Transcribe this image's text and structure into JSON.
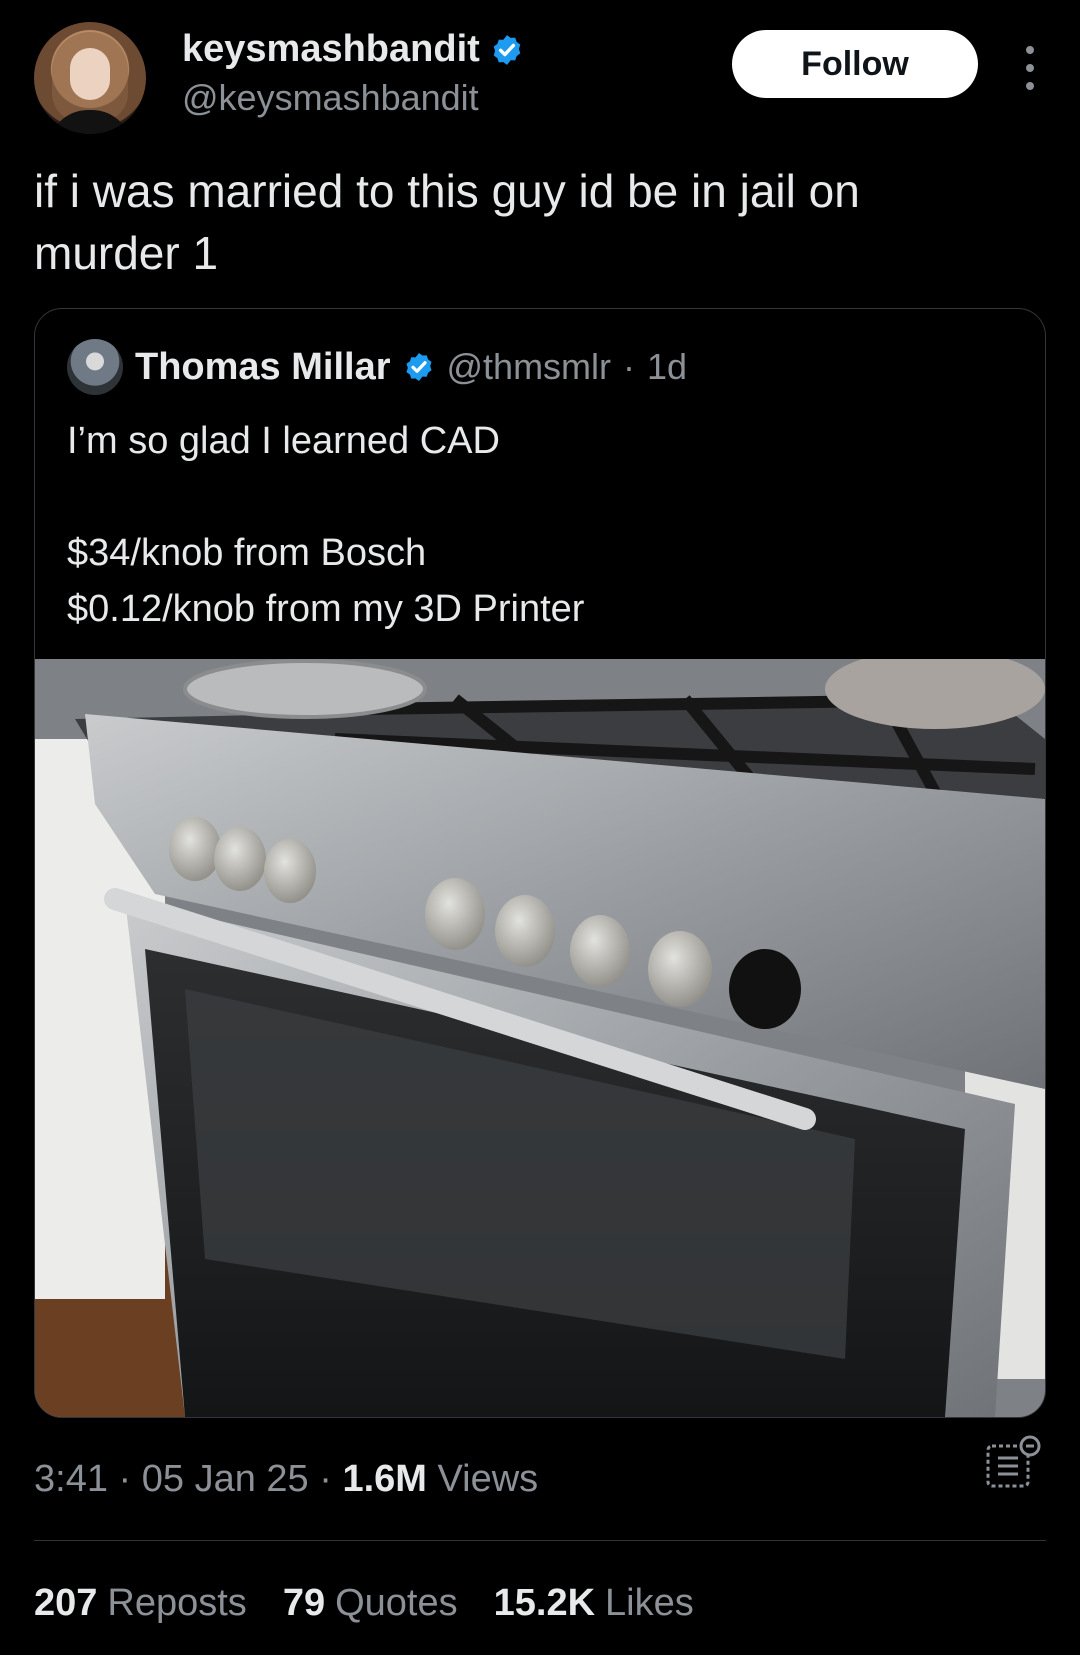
{
  "author": {
    "display_name": "keysmashbandit",
    "handle": "@keysmashbandit",
    "verified": true,
    "avatar_icon": "profile-photo"
  },
  "follow_label": "Follow",
  "more_icon": "more-vertical-icon",
  "tweet": {
    "text_line1": "if i was married to this guy id be in jail on",
    "text_line2": "murder 1"
  },
  "quoted": {
    "display_name": "Thomas Millar",
    "handle": "@thmsmlr",
    "separator": "·",
    "time": "1d",
    "verified": true,
    "line1": "I’m so glad I learned CAD",
    "line2": "$34/knob from Bosch",
    "line3": "$0.12/knob from my 3D Printer"
  },
  "meta": {
    "time": "3:41",
    "sep1": "·",
    "date": "05 Jan 25",
    "sep2": "·",
    "views_count": "1.6M",
    "views_label": "Views",
    "analytics_icon": "analytics-icon"
  },
  "stats": {
    "reposts_count": "207",
    "reposts_label": "Reposts",
    "quotes_count": "79",
    "quotes_label": "Quotes",
    "likes_count": "15.2K",
    "likes_label": "Likes"
  },
  "colors": {
    "background": "#000000",
    "text_primary": "#e7e9ea",
    "text_secondary": "#8b9197",
    "verified_blue": "#1d9bf0",
    "border": "#333639"
  }
}
